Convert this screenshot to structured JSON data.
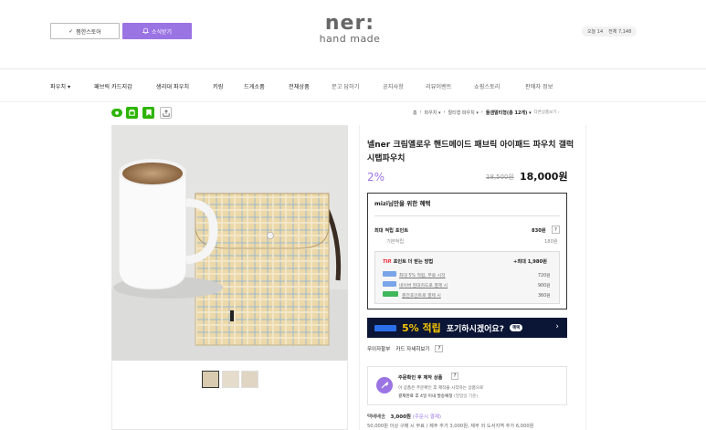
{
  "header": {
    "pick_store": "찜한스토어",
    "news": "소식받기",
    "logo_line1": "ner:",
    "logo_line2": "hand made",
    "today_label": "오늘 14",
    "total_label": "전체 7,148"
  },
  "nav": {
    "items": [
      "파우치",
      "패브릭 카드지갑",
      "생리대 파우치",
      "키링",
      "드게소품",
      "전체상품",
      "문고 답하기",
      "공지사항",
      "리뷰이벤트",
      "쇼핑스토리",
      "판매자 정보"
    ]
  },
  "breadcrumb": [
    "홈",
    "파우치",
    "멀티형 파우치",
    "돌갬멀티형(총 12개)"
  ],
  "breadcrumb_extra": "다른상품보기",
  "product": {
    "title": "넬ner 크림옐로우 핸드메이드 패브릭 아이패드 파우치 갤럭시탭파우치",
    "discount": "2%",
    "original_price": "18,500원",
    "price": "18,000원"
  },
  "benefit": {
    "title": "mizi님만을 위한 혜택",
    "max_points_label": "최대 적립 포인트",
    "max_points_value": "830원",
    "base_label": "기본적립",
    "base_value": "180원",
    "tip_label": "TIP.",
    "tip_text": "포인트 더 받는 방법",
    "tip_max": "+최대 1,980원",
    "tips": [
      {
        "text": "최대 5% 적립, 무료 시작",
        "value": "720원"
      },
      {
        "text": "네이버 현대카드로 결제 시",
        "value": "900원"
      },
      {
        "text": "충전포인트로 결제 시",
        "value": "360원"
      }
    ]
  },
  "banner": {
    "pct": "5% 적립",
    "question": "포기하시겠어요?",
    "count": "혜택"
  },
  "payment": {
    "label": "무이자할부",
    "link": "카드 자세히보기"
  },
  "made": {
    "title": "주문확인 후 제작 상품",
    "line1": "이 상품은 주문확인 후 제작을 시작하는 상품으로",
    "line2": "결제완료 후 4일 이내 발송예정",
    "line2_note": "(영업일 기준)"
  },
  "shipping": {
    "label": "택배배송",
    "fee": "3,000원",
    "note": "(주문시 결제)",
    "detail": "50,000원 이상 구매 시 무료 / 제주 추가 3,000원, 제주 외 도서지역 추가 6,000원"
  },
  "colors": {
    "accent": "#9b74e4",
    "banner_bg": "#0b1536",
    "banner_highlight": "#f5c400"
  }
}
